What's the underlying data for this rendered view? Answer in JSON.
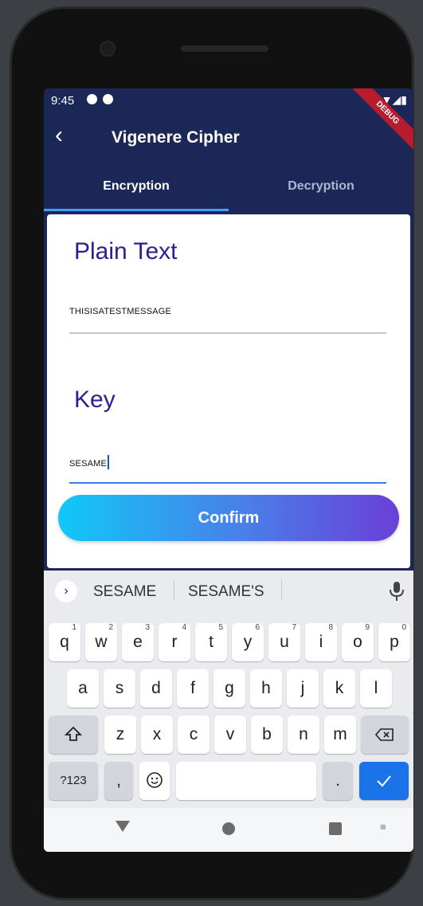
{
  "status": {
    "time": "9:45",
    "debug_label": "DEBUG"
  },
  "appbar": {
    "title": "Vigenere Cipher",
    "back_icon": "arrow-back-icon"
  },
  "tabs": [
    {
      "label": "Encryption",
      "active": true
    },
    {
      "label": "Decryption",
      "active": false
    }
  ],
  "form": {
    "plain_label": "Plain Text",
    "plain_value": "THISISATESTMESSAGE",
    "key_label": "Key",
    "key_value": "SESAME",
    "confirm_label": "Confirm"
  },
  "keyboard": {
    "suggestions": [
      "SESAME",
      "SESAME'S"
    ],
    "row1": [
      {
        "key": "q",
        "hint": "1"
      },
      {
        "key": "w",
        "hint": "2"
      },
      {
        "key": "e",
        "hint": "3"
      },
      {
        "key": "r",
        "hint": "4"
      },
      {
        "key": "t",
        "hint": "5"
      },
      {
        "key": "y",
        "hint": "6"
      },
      {
        "key": "u",
        "hint": "7"
      },
      {
        "key": "i",
        "hint": "8"
      },
      {
        "key": "o",
        "hint": "9"
      },
      {
        "key": "p",
        "hint": "0"
      }
    ],
    "row2": [
      "a",
      "s",
      "d",
      "f",
      "g",
      "h",
      "j",
      "k",
      "l"
    ],
    "row3": [
      "z",
      "x",
      "c",
      "v",
      "b",
      "n",
      "m"
    ],
    "symbols_label": "?123",
    "comma_label": ",",
    "period_label": "."
  },
  "colors": {
    "appbar_bg": "#1b2756",
    "tab_indicator": "#3ea0ff",
    "title_text": "#2a2190",
    "confirm_gradient_start": "#10c8f8",
    "confirm_gradient_end": "#6a3fd8",
    "enter_key": "#1a73e8"
  }
}
